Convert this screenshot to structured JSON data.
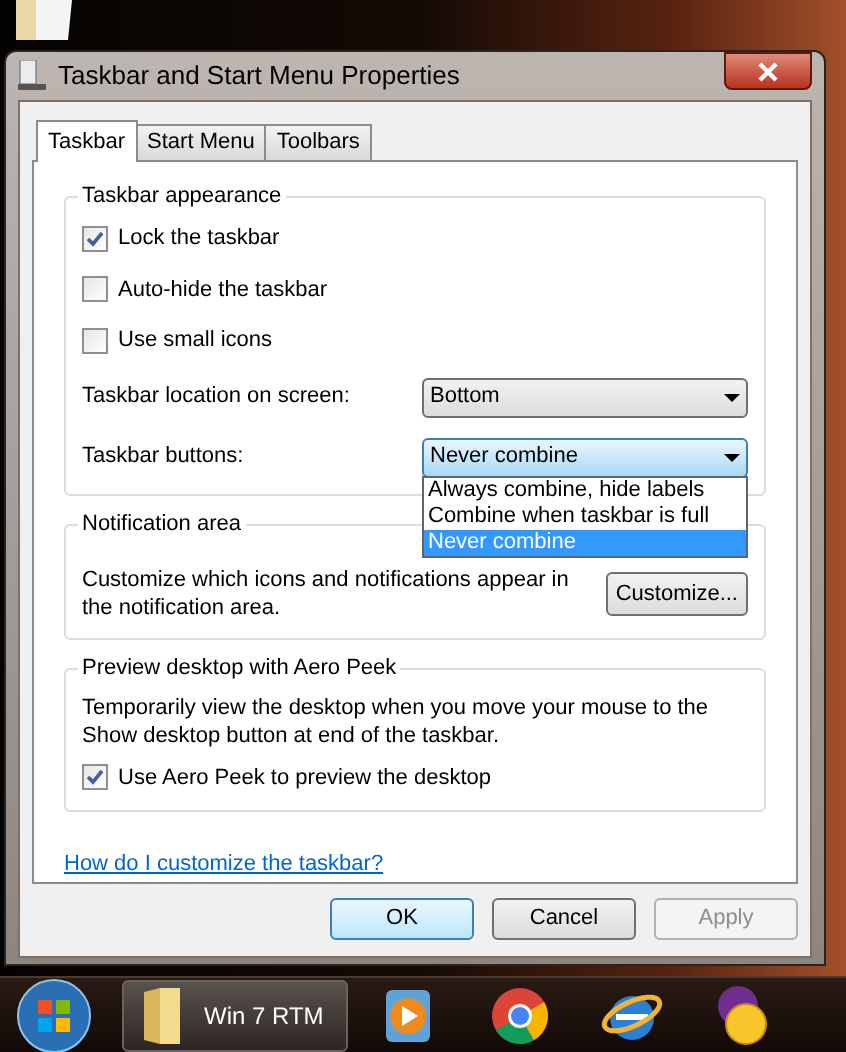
{
  "window": {
    "title": "Taskbar and Start Menu Properties"
  },
  "tabs": [
    {
      "label": "Taskbar",
      "selected": true
    },
    {
      "label": "Start Menu",
      "selected": false
    },
    {
      "label": "Toolbars",
      "selected": false
    }
  ],
  "taskbar_appearance": {
    "title": "Taskbar appearance",
    "checkboxes": [
      {
        "label": "Lock the taskbar",
        "checked": true
      },
      {
        "label": "Auto-hide the taskbar",
        "checked": false
      },
      {
        "label": "Use small icons",
        "checked": false
      }
    ],
    "location": {
      "label": "Taskbar location on screen:",
      "value": "Bottom",
      "expanded": false
    },
    "buttons_setting": {
      "label": "Taskbar buttons:",
      "value": "Never combine",
      "expanded": true,
      "options": [
        {
          "label": "Always combine, hide labels",
          "selected": false
        },
        {
          "label": "Combine when taskbar is full",
          "selected": false
        },
        {
          "label": "Never combine",
          "selected": true
        }
      ]
    }
  },
  "notification_area": {
    "title": "Notification area",
    "description": "Customize which icons and notifications appear in the notification area.",
    "button": "Customize..."
  },
  "aero_peek": {
    "title": "Preview desktop with Aero Peek",
    "description": "Temporarily view the desktop when you move your mouse to the Show desktop button at end of the taskbar.",
    "checkbox": {
      "label": "Use Aero Peek to preview the desktop",
      "checked": true
    }
  },
  "help_link": "How do I customize the taskbar?",
  "buttons": [
    {
      "label": "OK",
      "disabled": false,
      "default": true
    },
    {
      "label": "Cancel",
      "disabled": false,
      "default": false
    },
    {
      "label": "Apply",
      "disabled": true,
      "default": false
    }
  ],
  "taskbar": {
    "items": [
      {
        "kind": "start"
      },
      {
        "kind": "folder",
        "label": "Win 7 RTM"
      },
      {
        "kind": "player"
      },
      {
        "kind": "chrome"
      },
      {
        "kind": "ie"
      },
      {
        "kind": "messenger"
      }
    ]
  }
}
